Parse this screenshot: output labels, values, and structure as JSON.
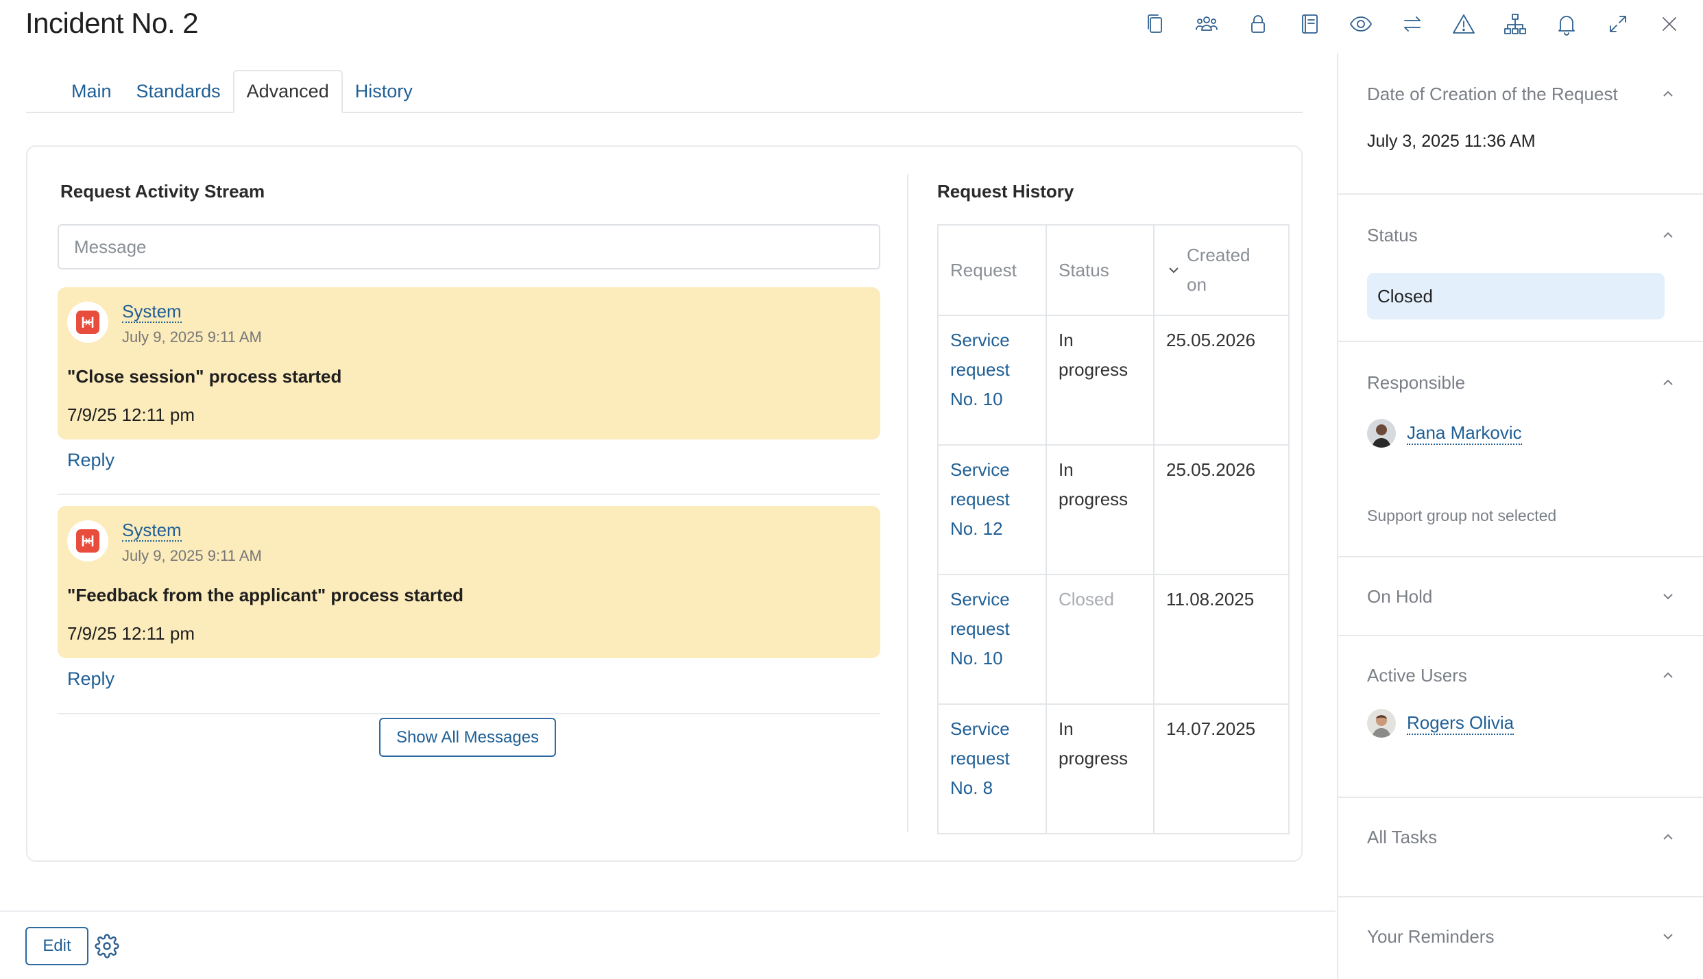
{
  "page": {
    "title": "Incident No. 2"
  },
  "toolbar": {
    "icons": [
      "copy-icon",
      "users-icon",
      "lock-icon",
      "book-icon",
      "eye-icon",
      "swap-icon",
      "warning-icon",
      "hierarchy-icon",
      "bell-icon",
      "expand-icon",
      "close-icon"
    ]
  },
  "tabs": [
    {
      "label": "Main"
    },
    {
      "label": "Standards"
    },
    {
      "label": "Advanced"
    },
    {
      "label": "History"
    }
  ],
  "activity": {
    "title": "Request Activity Stream",
    "message_placeholder": "Message",
    "posts": [
      {
        "author": "System",
        "time": "July 9, 2025 9:11 AM",
        "text": "\"Close session\" process started",
        "date": "7/9/25 12:11 pm",
        "reply": "Reply"
      },
      {
        "author": "System",
        "time": "July 9, 2025 9:11 AM",
        "text": "\"Feedback from the applicant\" process started",
        "date": "7/9/25 12:11 pm",
        "reply": "Reply"
      }
    ],
    "show_all": "Show All Messages"
  },
  "history": {
    "title": "Request History",
    "columns": [
      "Request",
      "Status",
      "Created on"
    ],
    "rows": [
      {
        "request": "Service request No. 10",
        "status": "In progress",
        "created": "25.05.2026"
      },
      {
        "request": "Service request No. 12",
        "status": "In progress",
        "created": "25.05.2026"
      },
      {
        "request": "Service request No. 10",
        "status": "Closed",
        "created": "11.08.2025"
      },
      {
        "request": "Service request No. 8",
        "status": "In progress",
        "created": "14.07.2025"
      }
    ]
  },
  "footer": {
    "edit": "Edit"
  },
  "sidebar": {
    "creation": {
      "label": "Date of Creation of the Request",
      "value": "July 3, 2025 11:36 AM"
    },
    "status": {
      "label": "Status",
      "value": "Closed"
    },
    "responsible": {
      "label": "Responsible",
      "user": "Jana Markovic",
      "note": "Support group not selected"
    },
    "on_hold": {
      "label": "On Hold"
    },
    "active_users": {
      "label": "Active Users",
      "user": "Rogers Olivia"
    },
    "all_tasks": {
      "label": "All Tasks"
    },
    "reminders": {
      "label": "Your Reminders"
    }
  },
  "colors": {
    "link": "#1f5f96",
    "post_bg": "#fcebbb",
    "status_pill": "#e3f0fb",
    "logo": "#e74c3c"
  }
}
